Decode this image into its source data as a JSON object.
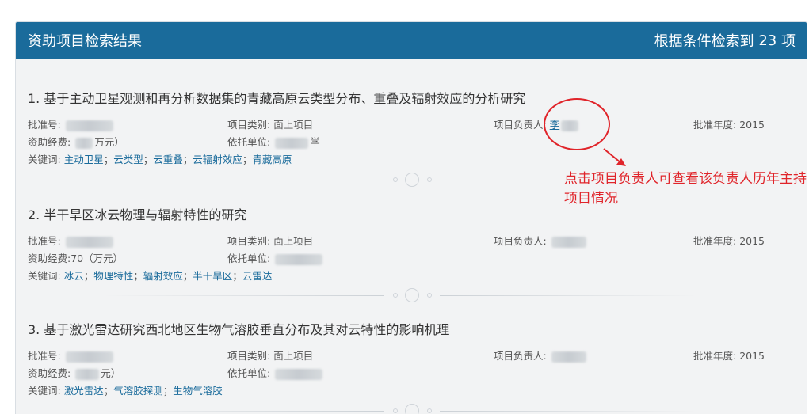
{
  "header": {
    "title": "资助项目检索结果",
    "count_prefix": "根据条件检索到",
    "count": "23",
    "count_suffix": "项"
  },
  "labels": {
    "approval_no": "批准号:",
    "category": "项目类别:",
    "leader": "项目负责人:",
    "year": "批准年度:",
    "funding": "资助经费:",
    "funding_unit": "（万元）",
    "org": "依托单位:",
    "keywords": "关键词:"
  },
  "projects": [
    {
      "title": "1. 基于主动卫星观测和再分析数据集的青藏高原云类型分布、重叠及辐射效应的分析研究",
      "category": "面上项目",
      "leader": "李",
      "year": "2015",
      "funding": "",
      "funding_unit": "万元）",
      "org_suffix": "学",
      "keywords": [
        "主动卫星",
        "云类型",
        "云重叠",
        "云辐射效应",
        "青藏高原"
      ],
      "kw_sep": "；"
    },
    {
      "title": "2. 半干旱区冰云物理与辐射特性的研究",
      "category": "面上项目",
      "leader": "",
      "year": "2015",
      "funding": "70",
      "funding_unit": "（万元）",
      "org_suffix": "",
      "keywords": [
        "冰云",
        "物理特性",
        "辐射效应",
        "半干旱区",
        "云雷达"
      ],
      "kw_sep": "；"
    },
    {
      "title": "3. 基于激光雷达研究西北地区生物气溶胶垂直分布及其对云特性的影响机理",
      "category": "面上项目",
      "leader": "",
      "year": "2015",
      "funding": "",
      "funding_unit": "元）",
      "org_suffix": "",
      "keywords": [
        "激光雷达",
        "气溶胶探测",
        "生物气溶胶"
      ],
      "kw_sep": "；"
    }
  ],
  "annotation": {
    "text": "点击项目负责人可查看该负责人历年主持项目情况",
    "color": "#e0242a"
  },
  "colors": {
    "header_bg": "#1a6b9b",
    "link": "#1a6b9b",
    "panel_bg": "#f2f3f4"
  }
}
